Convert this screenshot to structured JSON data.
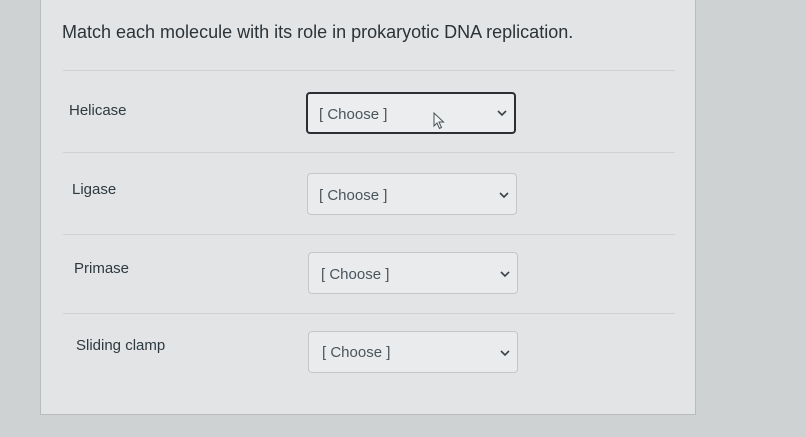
{
  "question": {
    "prompt": "Match each molecule with its role in prokaryotic DNA replication."
  },
  "matches": [
    {
      "term": "Helicase",
      "selected": "[ Choose ]"
    },
    {
      "term": "Ligase",
      "selected": "[ Choose ]"
    },
    {
      "term": "Primase",
      "selected": "[ Choose ]"
    },
    {
      "term": "Sliding clamp",
      "selected": "[ Choose ]"
    }
  ],
  "icons": {
    "dropdown": "chevron-down-icon",
    "pointer": "mouse-pointer-icon"
  }
}
